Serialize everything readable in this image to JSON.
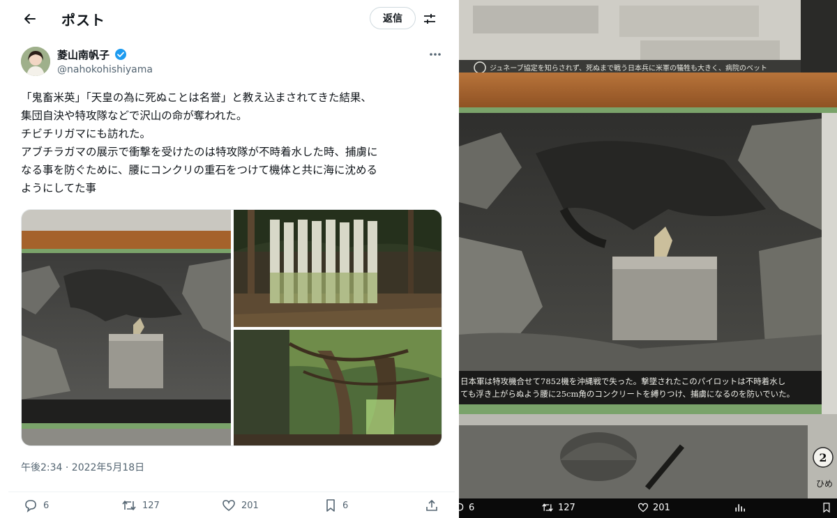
{
  "header": {
    "title": "ポスト",
    "reply_button_label": "返信"
  },
  "author": {
    "name": "菱山南帆子",
    "handle": "@nahokohishiyama"
  },
  "tweet": {
    "lines": [
      "「鬼畜米英」「天皇の為に死ぬことは名誉」と教え込まされてきた結果、",
      "集団自決や特攻隊などで沢山の命が奪われた。",
      "チビチリガマにも訪れた。",
      "アブチラガマの展示で衝撃を受けたのは特攻隊が不時着水した時、捕虜に",
      "なる事を防ぐために、腰にコンクリの重石をつけて機体と共に海に沈める",
      "ようにしてた事"
    ],
    "timestamp": "午後2:34 · 2022年5月18日"
  },
  "actions": {
    "replies": "6",
    "retweets": "127",
    "likes": "201",
    "bookmarks": "6"
  },
  "photo": {
    "caption_line1": "日本軍は特攻機合せて7852機を沖縄戦で失った。撃墜されたこのパイロットは不時着水し",
    "caption_line2": "ても浮き上がらぬよう腰に25cm角のコンクリートを縛りつけ、捕虜になるのを防いでいた。",
    "top_caption": "ジュネーブ協定を知らされず、死ぬまで戦う日本兵に米軍の犠牲も大きく、病院のベット",
    "panel_number": "2",
    "corner_text": "ひめ"
  },
  "photo_actions": {
    "replies": "6",
    "retweets": "127",
    "likes": "201"
  },
  "colors": {
    "accent": "#1d9bf0",
    "frame_wood": "#a5622b",
    "photo_green_border": "#7aa36a"
  }
}
